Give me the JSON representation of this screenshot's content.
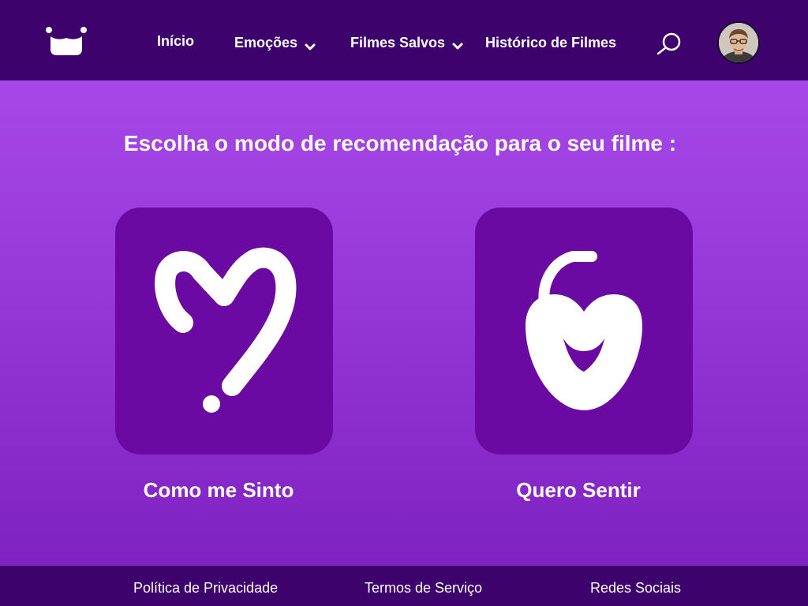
{
  "header": {
    "logo_icon": "smile-logo-icon",
    "nav": {
      "home": "Início",
      "emotions": "Emoções",
      "saved_movies": "Filmes Salvos",
      "history": "Histórico de Filmes"
    },
    "search_icon": "search-icon",
    "avatar_icon": "user-avatar"
  },
  "main": {
    "headline": "Escolha o modo de recomendação para o seu filme :",
    "options": [
      {
        "label": "Como me Sinto",
        "icon": "heart-question-icon"
      },
      {
        "label": "Quero Sentir",
        "icon": "heart-lock-icon"
      }
    ]
  },
  "footer": {
    "privacy": "Política de Privacidade",
    "terms": "Termos de Serviço",
    "social": "Redes Sociais"
  },
  "colors": {
    "header_bg": "#3d026c",
    "card_bg": "#6a0aa3",
    "gradient_top": "#ad4ded",
    "gradient_bottom": "#7b1fbe"
  }
}
